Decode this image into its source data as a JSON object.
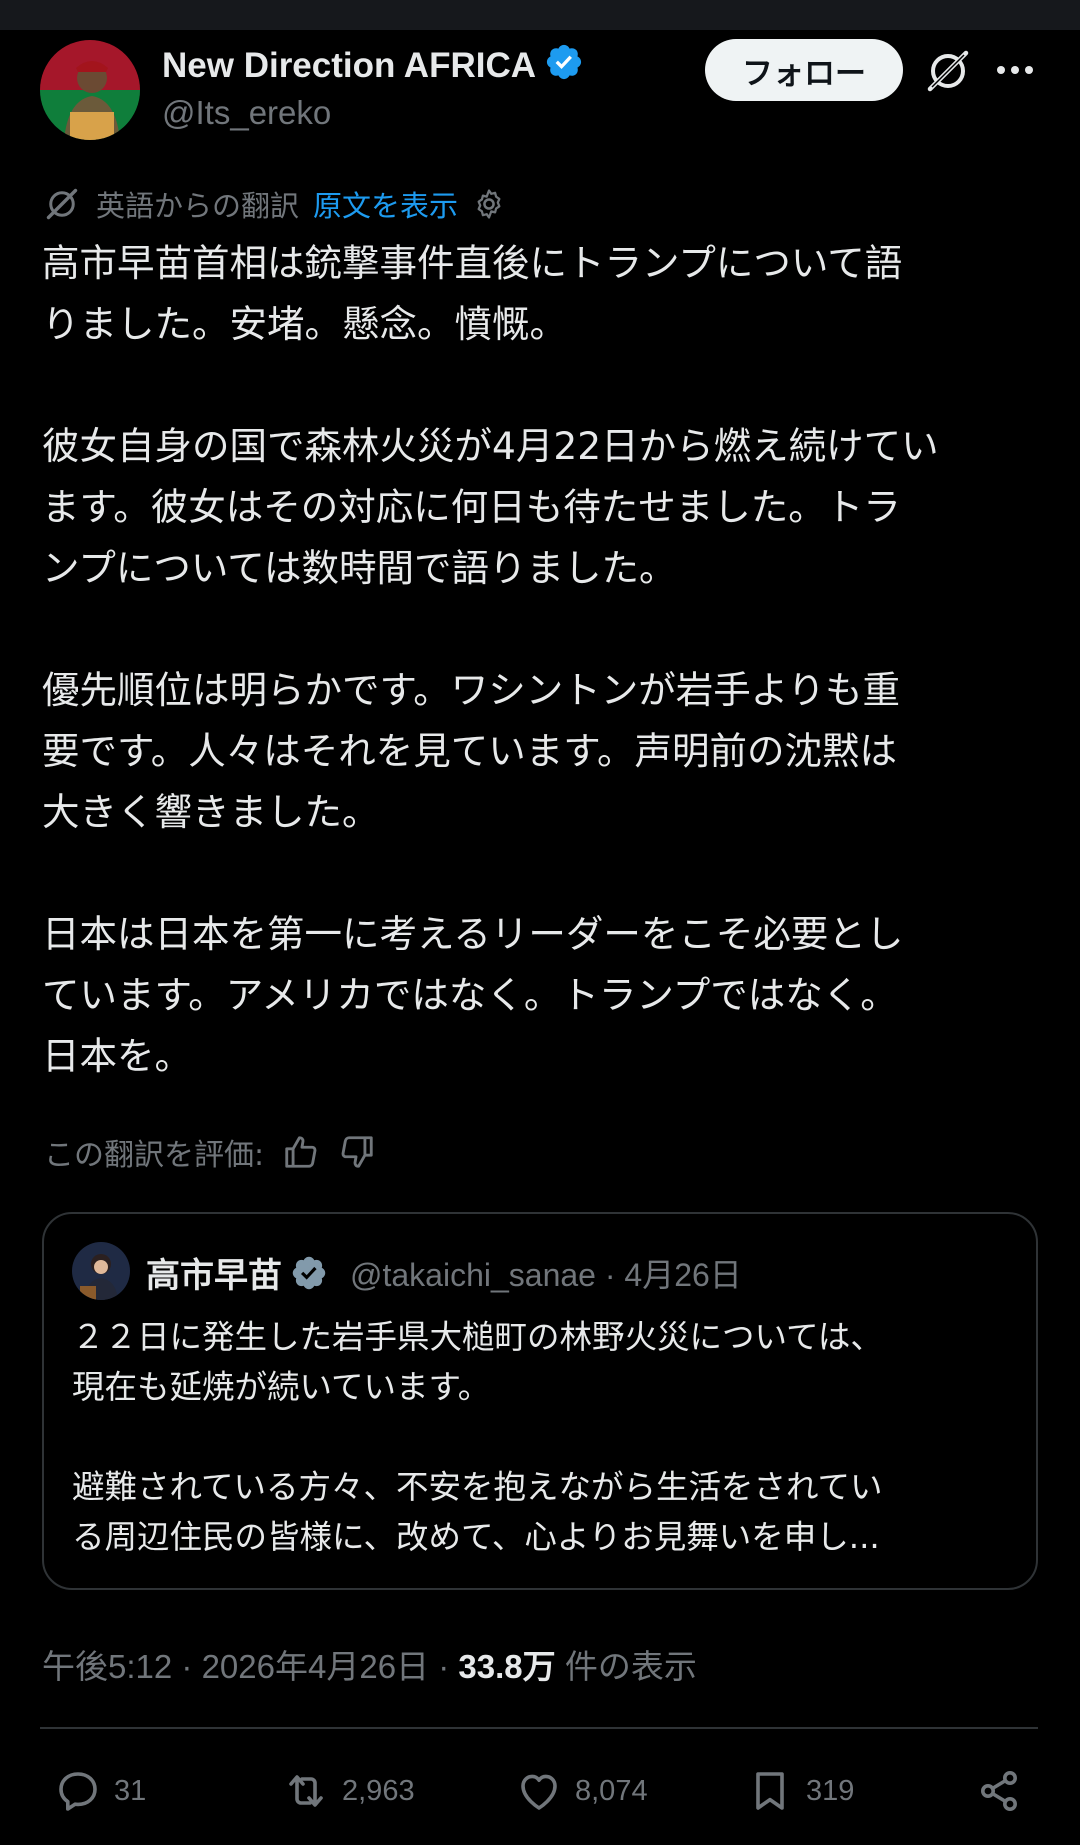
{
  "author": {
    "display_name": "New Direction AFRICA",
    "handle": "@Its_ereko",
    "verified": true
  },
  "header": {
    "follow_label": "フォロー",
    "grok_icon": "grok-icon",
    "more_icon": "more-icon"
  },
  "translation": {
    "label": "英語からの翻訳",
    "show_original": "原文を表示"
  },
  "tweet": {
    "text": "高市早苗首相は銃撃事件直後にトランプについて語\nりました。安堵。懸念。憤慨。\n\n彼女自身の国で森林火災が4月22日から燃え続けてい\nます。彼女はその対応に何日も待たせました。トラ\nンプについては数時間で語りました。\n\n優先順位は明らかです。ワシントンが岩手よりも重\n要です。人々はそれを見ています。声明前の沈黙は\n大きく響きました。\n\n日本は日本を第一に考えるリーダーをこそ必要とし\nています。アメリカではなく。トランプではなく。\n日本を。"
  },
  "rate": {
    "label": "この翻訳を評価:"
  },
  "quoted": {
    "name": "高市早苗",
    "handle": "@takaichi_sanae",
    "date": "4月26日",
    "text": "２２日に発生した岩手県大槌町の林野火災については、\n現在も延焼が続いています。\n\n避難されている方々、不安を抱えながら生活をされてい\nる周辺住民の皆様に、改めて、心よりお見舞いを申し..."
  },
  "meta": {
    "time": "午後5:12",
    "date": "2026年4月26日",
    "views_count": "33.8万",
    "views_label": "件の表示"
  },
  "actions": {
    "replies": "31",
    "reposts": "2,963",
    "likes": "8,074",
    "bookmarks": "319"
  },
  "colors": {
    "background": "#000000",
    "text": "#e7e9ea",
    "secondary": "#71767b",
    "accent": "#1d9bf0",
    "border": "#2f3336"
  }
}
